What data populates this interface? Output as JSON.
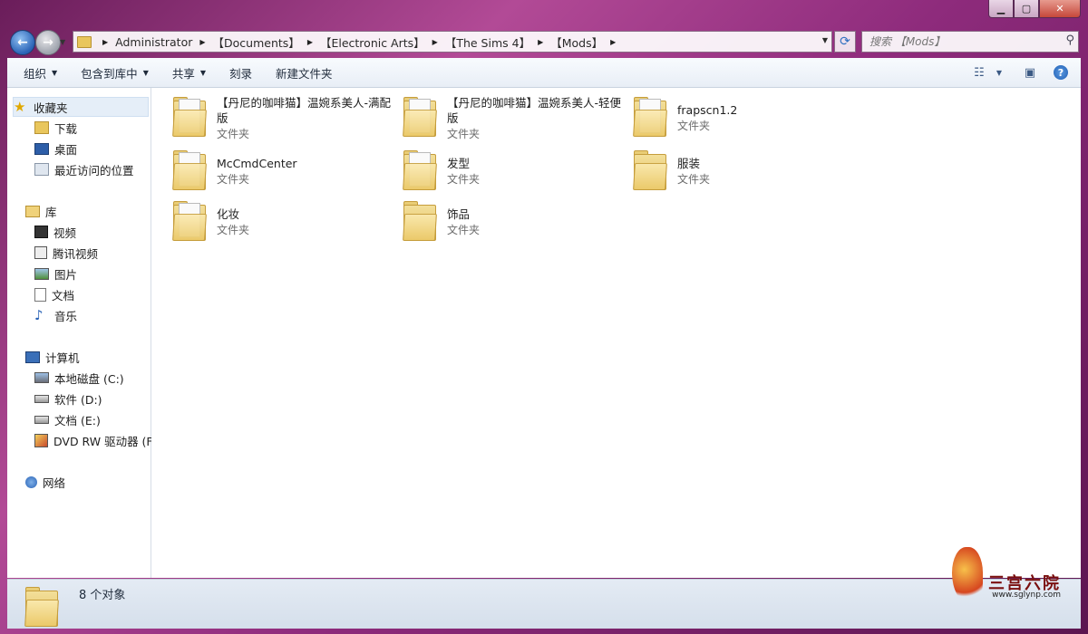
{
  "window": {
    "minimize_icon": "minimize-icon",
    "maximize_icon": "maximize-icon",
    "close_icon": "close-icon"
  },
  "nav": {
    "back_icon": "back-arrow-icon",
    "forward_icon": "forward-arrow-icon"
  },
  "address": {
    "segments": [
      "Administrator",
      "【Documents】",
      "【Electronic Arts】",
      "【The Sims 4】",
      "【Mods】"
    ]
  },
  "search": {
    "placeholder": "搜索 【Mods】"
  },
  "toolbar": {
    "organize": "组织",
    "include_library": "包含到库中",
    "share": "共享",
    "burn": "刻录",
    "new_folder": "新建文件夹"
  },
  "sidebar": {
    "favorites": {
      "label": "收藏夹",
      "items": [
        "下载",
        "桌面",
        "最近访问的位置"
      ]
    },
    "libraries": {
      "label": "库",
      "items": [
        "视频",
        "腾讯视频",
        "图片",
        "文档",
        "音乐"
      ]
    },
    "computer": {
      "label": "计算机",
      "items": [
        "本地磁盘 (C:)",
        "软件 (D:)",
        "文档 (E:)",
        "DVD RW 驱动器 (F:"
      ]
    },
    "network": {
      "label": "网络"
    }
  },
  "files": [
    {
      "name": "【丹尼的咖啡猫】温婉系美人-满配版",
      "type": "文件夹"
    },
    {
      "name": "【丹尼的咖啡猫】温婉系美人-轻便版",
      "type": "文件夹"
    },
    {
      "name": "frapscn1.2",
      "type": "文件夹"
    },
    {
      "name": "McCmdCenter",
      "type": "文件夹"
    },
    {
      "name": "发型",
      "type": "文件夹"
    },
    {
      "name": "服装",
      "type": "文件夹"
    },
    {
      "name": "化妆",
      "type": "文件夹"
    },
    {
      "name": "饰品",
      "type": "文件夹"
    }
  ],
  "status": {
    "count": "8 个对象"
  },
  "watermark": {
    "title": "三宫六院",
    "url": "www.sglynp.com"
  },
  "colors": {
    "accent": "#2a63b6",
    "folder": "#e9c65c",
    "window_frame": "#8e2b7c"
  }
}
